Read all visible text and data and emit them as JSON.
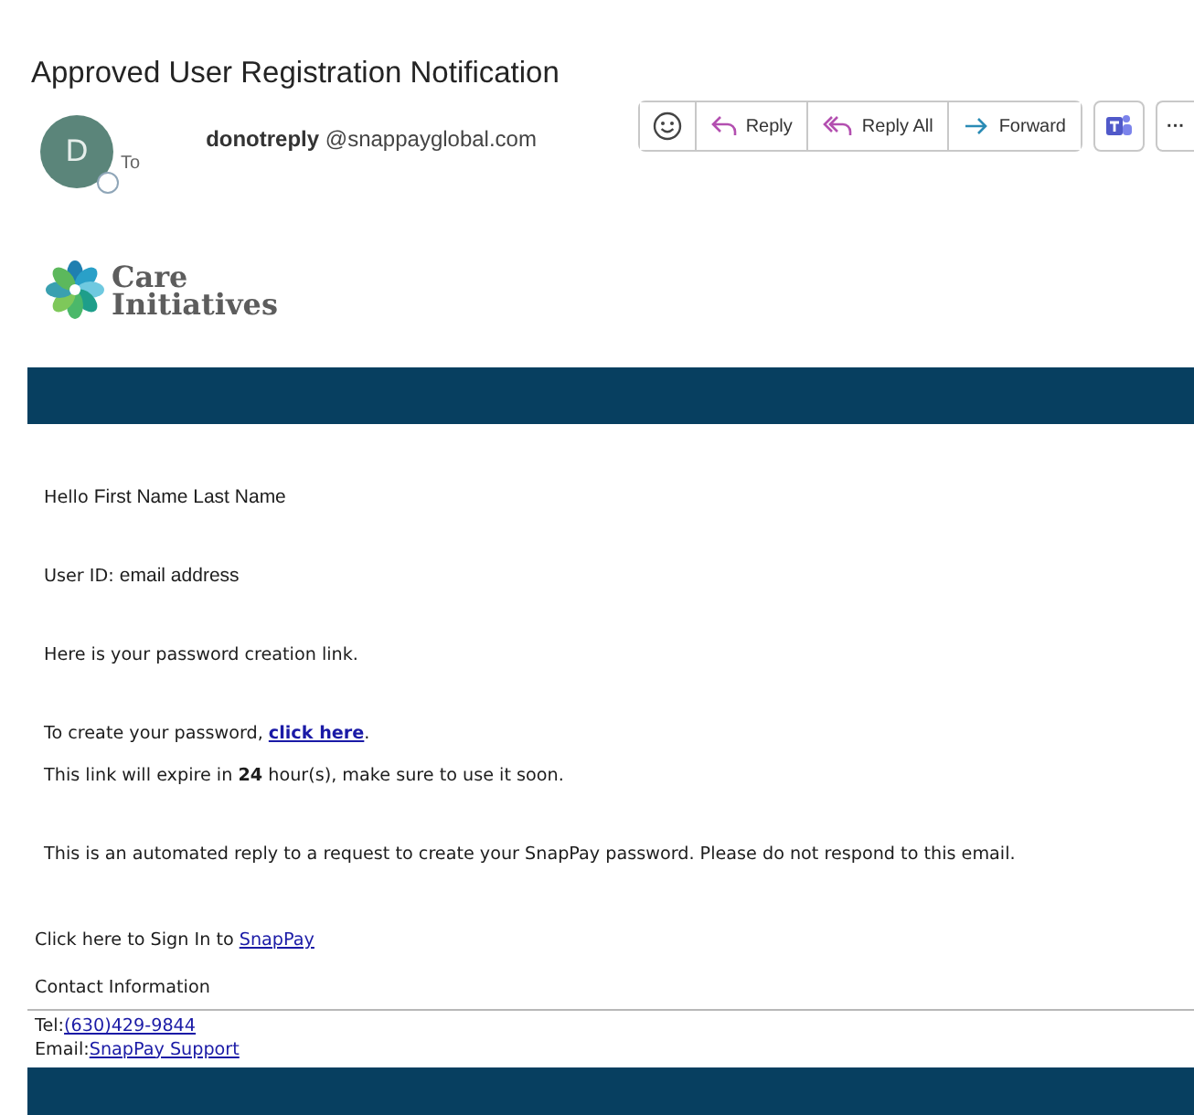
{
  "subject": "Approved User Registration Notification",
  "sender": {
    "initial": "D",
    "name": "donotreply",
    "address": "@snappayglobal.com",
    "to_label": "To"
  },
  "actions": [
    {
      "kind": "emoji"
    },
    {
      "kind": "reply",
      "label": "Reply"
    },
    {
      "kind": "reply_all",
      "label": "Reply All"
    },
    {
      "kind": "forward",
      "label": "Forward"
    },
    {
      "kind": "teams"
    },
    {
      "kind": "more",
      "label": "···"
    }
  ],
  "logo": {
    "line1": "Care",
    "line2": "Initiatives"
  },
  "greeting": {
    "word": "Hello",
    "recipient": "First Name Last Name"
  },
  "user_id": {
    "label": "User ID:",
    "value": "email address"
  },
  "blocks": [
    [
      {
        "parts": [
          {
            "kind": "text",
            "text": "Here is your password creation link."
          }
        ]
      }
    ],
    [
      {
        "parts": [
          {
            "kind": "text",
            "text": "To create your password, "
          },
          {
            "kind": "bold_link",
            "text": "click here"
          },
          {
            "kind": "text",
            "text": "."
          }
        ]
      },
      {
        "parts": [
          {
            "kind": "text",
            "text": "This link will expire in **24** hour(s), make sure to use it soon."
          }
        ]
      }
    ],
    [
      {
        "parts": [
          {
            "kind": "text",
            "text": "This is an automated reply to a request to create your SnapPay password. Please do not respond to this email."
          }
        ]
      }
    ]
  ],
  "signin": {
    "parts": [
      {
        "kind": "text",
        "text": "Click here to Sign In to "
      },
      {
        "kind": "link",
        "text": "SnapPay"
      }
    ]
  },
  "contact": {
    "heading": "Contact Information",
    "rows": [
      {
        "label": "Tel:",
        "link": "(630)429-9844"
      },
      {
        "label": "Email:",
        "link": "SnapPay Support"
      }
    ]
  }
}
